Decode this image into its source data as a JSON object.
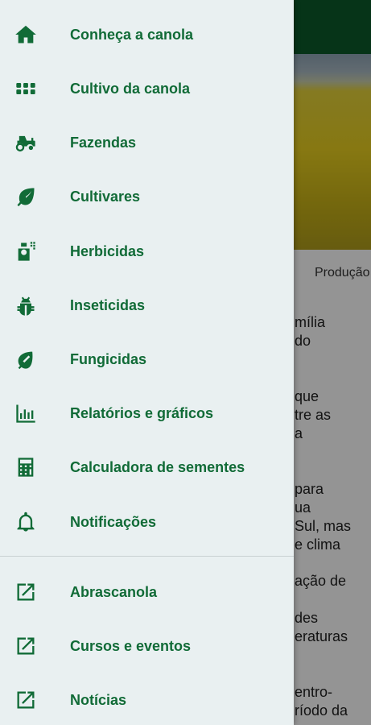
{
  "background": {
    "tab_label": "Produção",
    "text_lines": [
      "mília",
      "do",
      "que",
      "tre as",
      "a",
      "para",
      "ua",
      "Sul, mas",
      "e clima",
      "ação de",
      "des",
      "eraturas",
      "entro-",
      "ríodo da"
    ]
  },
  "drawer": {
    "items": [
      {
        "label": "Conheça a canola",
        "icon": "home-icon"
      },
      {
        "label": "Cultivo da canola",
        "icon": "grid-icon"
      },
      {
        "label": "Fazendas",
        "icon": "tractor-icon"
      },
      {
        "label": "Cultivares",
        "icon": "leaf-icon"
      },
      {
        "label": "Herbicidas",
        "icon": "spray-bottle-icon"
      },
      {
        "label": "Inseticidas",
        "icon": "bug-icon"
      },
      {
        "label": "Fungicidas",
        "icon": "leaf-outline-icon"
      },
      {
        "label": "Relatórios e gráficos",
        "icon": "bar-chart-icon"
      },
      {
        "label": "Calculadora de sementes",
        "icon": "calculator-icon"
      },
      {
        "label": "Notificações",
        "icon": "bell-icon"
      }
    ],
    "links": [
      {
        "label": "Abrascanola",
        "icon": "external-link-icon"
      },
      {
        "label": "Cursos e eventos",
        "icon": "external-link-icon"
      },
      {
        "label": "Notícias",
        "icon": "external-link-icon"
      }
    ]
  },
  "colors": {
    "accent": "#116b37",
    "drawer_bg": "#e9f0f1",
    "topbar": "#0b5a2a"
  }
}
